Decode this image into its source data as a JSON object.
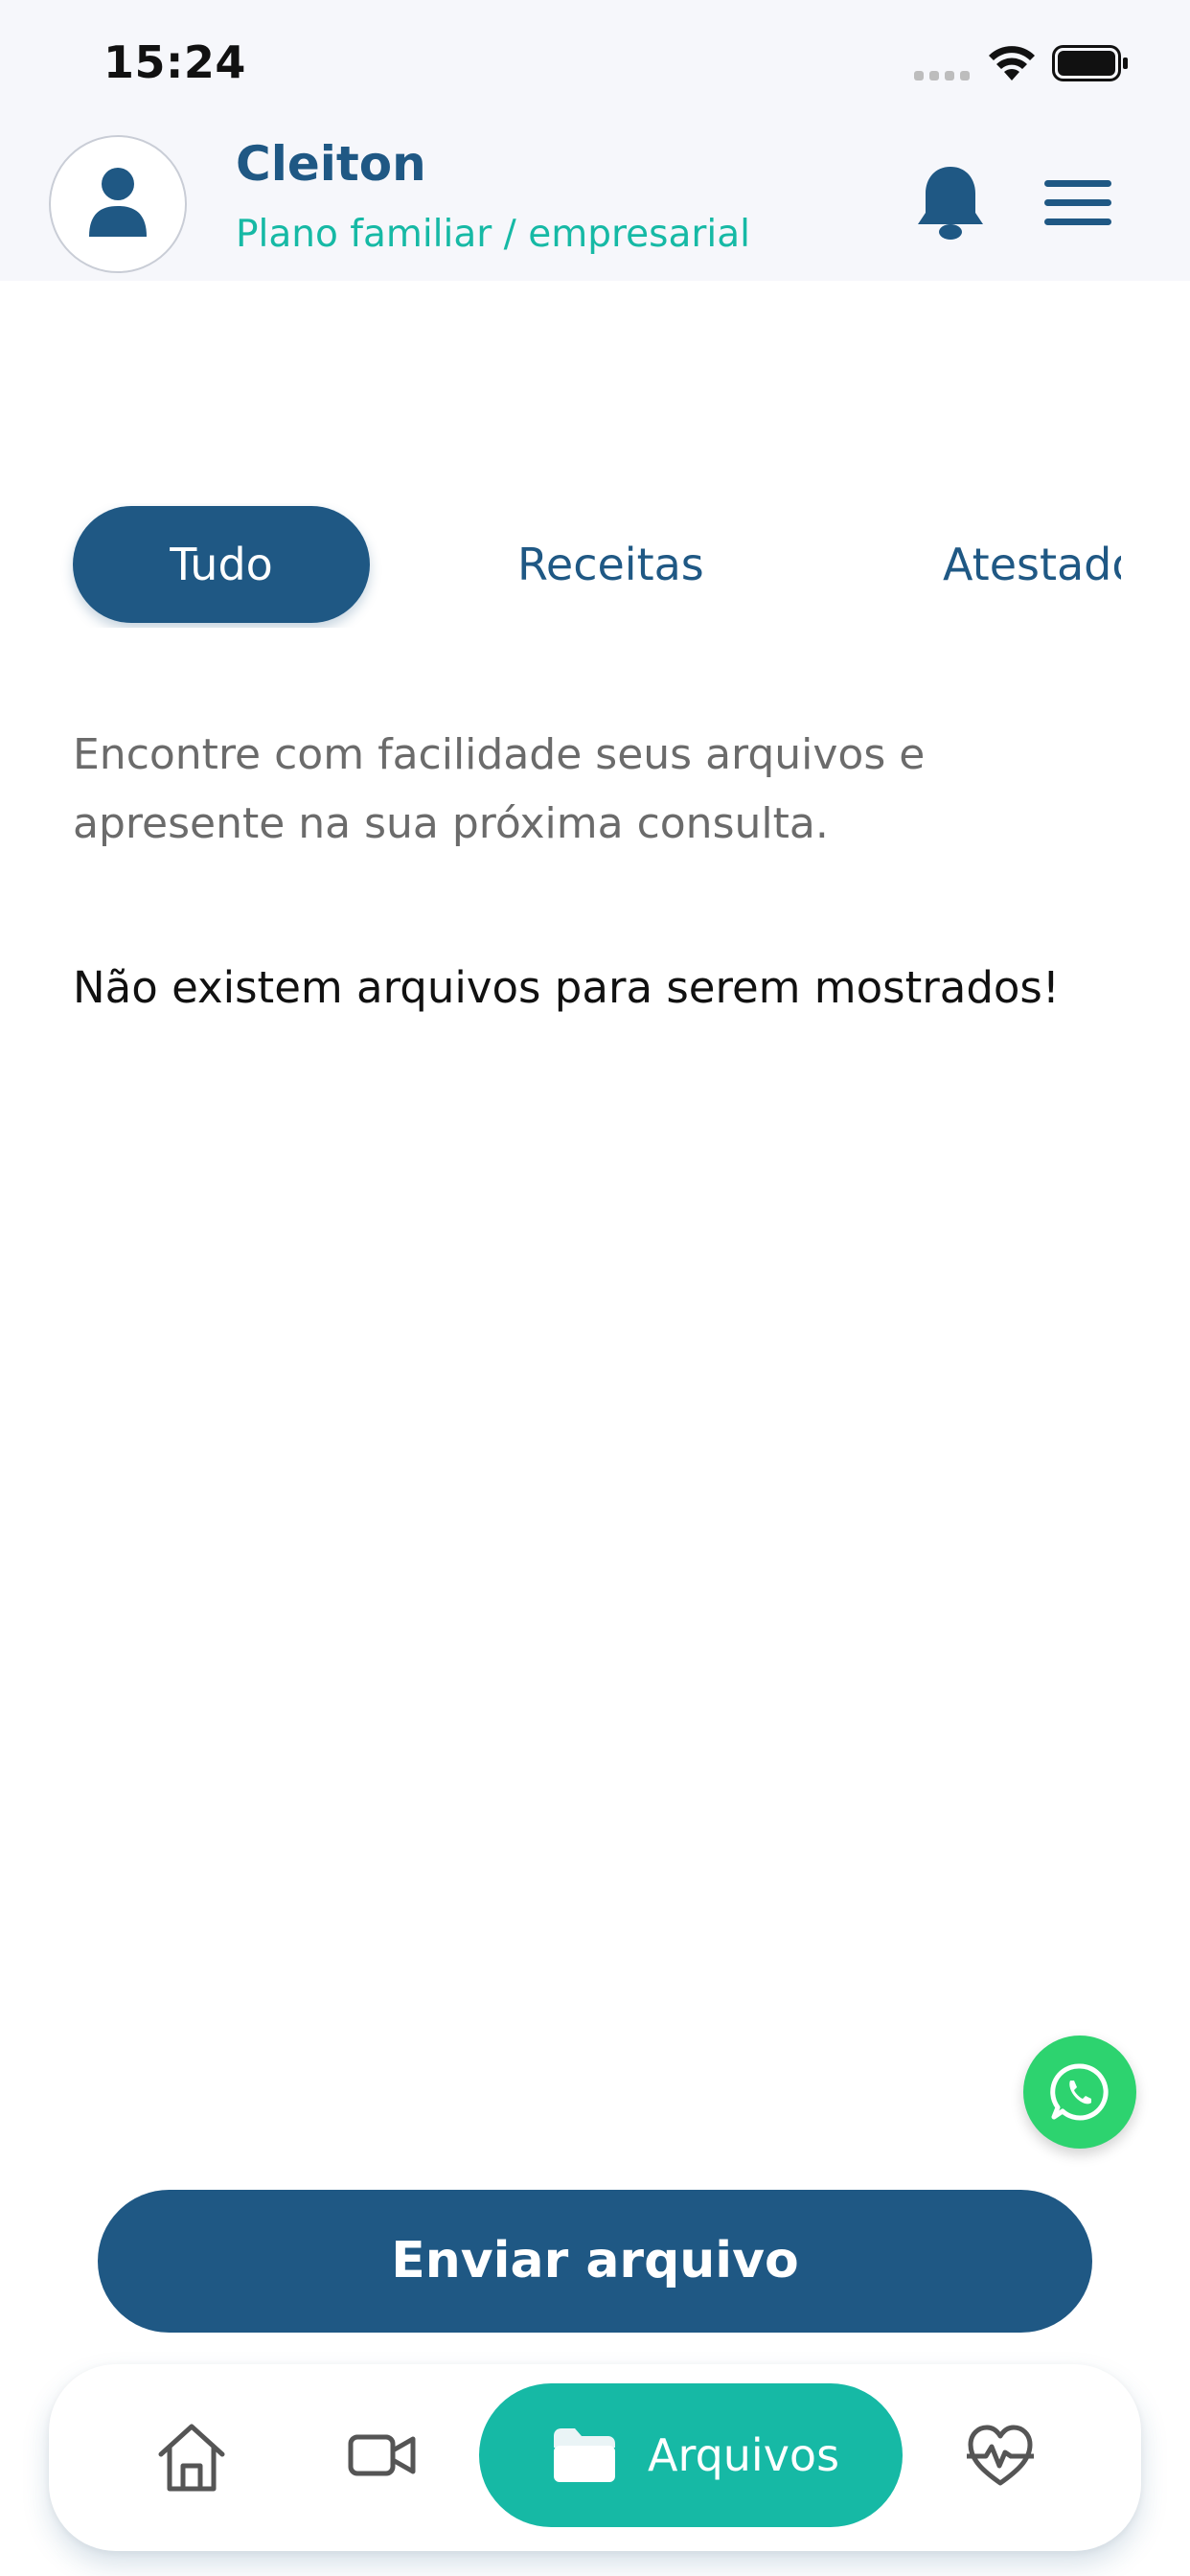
{
  "status_bar": {
    "time": "15:24"
  },
  "header": {
    "user_name": "Cleiton",
    "plan": "Plano familiar / empresarial",
    "icons": [
      "user-icon",
      "bell-icon",
      "menu-icon"
    ]
  },
  "tabs": [
    {
      "label": "Tudo",
      "active": true
    },
    {
      "label": "Receitas",
      "active": false
    },
    {
      "label": "Atestados",
      "active": false
    }
  ],
  "content": {
    "description": "Encontre com facilidade seus arquivos e apresente na sua próxima consulta.",
    "empty_message": "Não existem arquivos para serem mostrados!"
  },
  "actions": {
    "send_file": "Enviar arquivo"
  },
  "bottom_nav": {
    "items": [
      {
        "icon": "home-icon"
      },
      {
        "icon": "video-icon"
      },
      {
        "icon": "folder-icon",
        "label": "Arquivos",
        "active": true
      },
      {
        "icon": "heart-pulse-icon"
      }
    ]
  },
  "colors": {
    "primary": "#1f5884",
    "accent": "#16b9a5",
    "whatsapp": "#2dd36f",
    "header_bg": "#f6f7fb"
  }
}
